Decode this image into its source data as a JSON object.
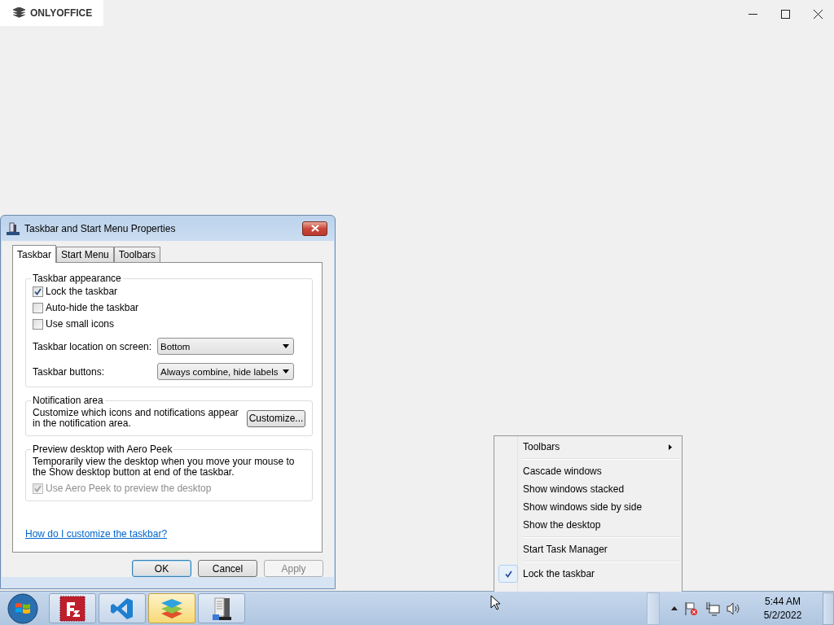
{
  "app_tab": {
    "label": "ONLYOFFICE"
  },
  "dialog": {
    "title": "Taskbar and Start Menu Properties",
    "tabs": [
      {
        "label": "Taskbar",
        "selected": true
      },
      {
        "label": "Start Menu",
        "selected": false
      },
      {
        "label": "Toolbars",
        "selected": false
      }
    ],
    "groups": [
      {
        "title": "Taskbar appearance",
        "items": [
          {
            "kind": "checkbox",
            "label": "Lock the taskbar",
            "checked": true,
            "disabled": false
          },
          {
            "kind": "checkbox",
            "label": "Auto-hide the taskbar",
            "checked": false,
            "disabled": false
          },
          {
            "kind": "checkbox",
            "label": "Use small icons",
            "checked": false,
            "disabled": false
          },
          {
            "kind": "dropdown",
            "label": "Taskbar location on screen:",
            "value": "Bottom"
          },
          {
            "kind": "dropdown",
            "label": "Taskbar buttons:",
            "value": "Always combine, hide labels"
          }
        ]
      },
      {
        "title": "Notification area",
        "items": [
          {
            "kind": "text_button",
            "text": "Customize which icons and notifications appear in the notification area.",
            "button": "Customize..."
          }
        ]
      },
      {
        "title": "Preview desktop with Aero Peek",
        "items": [
          {
            "kind": "text",
            "text": "Temporarily view the desktop when you move your mouse to the Show desktop button at end of the taskbar."
          },
          {
            "kind": "checkbox",
            "label": "Use Aero Peek to preview the desktop",
            "checked": true,
            "disabled": true
          }
        ]
      }
    ],
    "help_link": "How do I customize the taskbar?",
    "buttons": [
      {
        "label": "OK",
        "default": true,
        "disabled": false
      },
      {
        "label": "Cancel",
        "default": false,
        "disabled": false
      },
      {
        "label": "Apply",
        "default": false,
        "disabled": true
      }
    ]
  },
  "context_menu": {
    "items": [
      {
        "kind": "submenu",
        "label": "Toolbars",
        "checked": false
      },
      {
        "kind": "separator"
      },
      {
        "kind": "item",
        "label": "Cascade windows",
        "checked": false
      },
      {
        "kind": "item",
        "label": "Show windows stacked",
        "checked": false
      },
      {
        "kind": "item",
        "label": "Show windows side by side",
        "checked": false
      },
      {
        "kind": "item",
        "label": "Show the desktop",
        "checked": false
      },
      {
        "kind": "separator"
      },
      {
        "kind": "item",
        "label": "Start Task Manager",
        "checked": false
      },
      {
        "kind": "separator"
      },
      {
        "kind": "item",
        "label": "Lock the taskbar",
        "checked": true
      }
    ]
  },
  "taskbar": {
    "apps": [
      {
        "kind": "red-square",
        "active": false
      },
      {
        "kind": "chevron",
        "active": false
      },
      {
        "kind": "layers",
        "active": true
      },
      {
        "kind": "server",
        "active": false
      }
    ],
    "clock": {
      "time": "5:44 AM",
      "date": "5/2/2022"
    }
  }
}
